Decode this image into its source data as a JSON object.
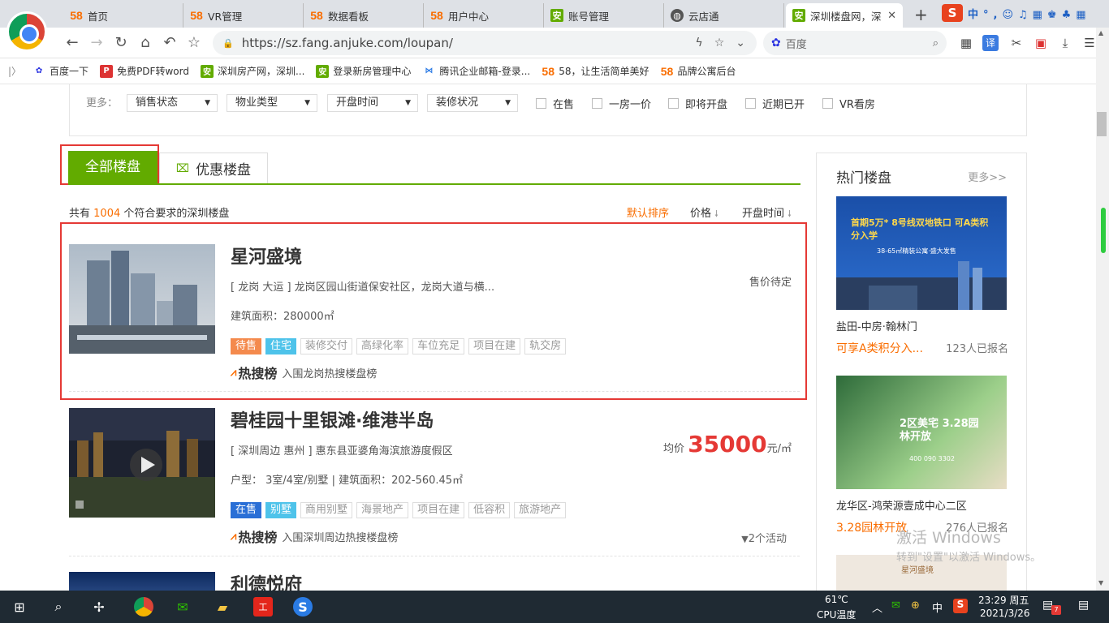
{
  "tabs": [
    {
      "icon": "58",
      "label": "首页"
    },
    {
      "icon": "58",
      "label": "VR管理"
    },
    {
      "icon": "58",
      "label": "数据看板"
    },
    {
      "icon": "58",
      "label": "用户中心"
    },
    {
      "icon": "安",
      "label": "账号管理"
    },
    {
      "icon": "globe",
      "label": "云店通"
    },
    {
      "icon": "安",
      "label": "深圳楼盘网，深"
    }
  ],
  "url": "https://sz.fang.anjuke.com/loupan/",
  "search_placeholder": "百度",
  "bookmarks": [
    "百度一下",
    "免费PDF转word",
    "深圳房产网，深圳...",
    "登录新房管理中心",
    "腾讯企业邮箱-登录...",
    "58，让生活简单美好",
    "品牌公寓后台"
  ],
  "filters": {
    "more_label": "更多：",
    "dropdowns": [
      "销售状态",
      "物业类型",
      "开盘时间",
      "装修状况"
    ],
    "checkboxes": [
      "在售",
      "一房一价",
      "即将开盘",
      "近期已开",
      "VR看房"
    ]
  },
  "list_tabs": {
    "all": "全部楼盘",
    "deals": "优惠楼盘"
  },
  "result": {
    "prefix": "共有",
    "count": "1004",
    "suffix": "个符合要求的深圳楼盘"
  },
  "sort": {
    "default": "默认排序",
    "price": "价格",
    "open_time": "开盘时间"
  },
  "listings": [
    {
      "name": "星河盛境",
      "address": "[ 龙岗 大运 ] 龙岗区园山街道保安社区，龙岗大道与横...",
      "info": "建筑面积：280000㎡",
      "status_tag": "待售",
      "type_tag": "住宅",
      "tags": [
        "装修交付",
        "高绿化率",
        "车位充足",
        "项目在建",
        "轨交房"
      ],
      "hot_label": "热搜榜",
      "hot_text": "入围龙岗热搜楼盘榜",
      "price_text": "售价待定"
    },
    {
      "name": "碧桂园十里银滩·维港半岛",
      "address": "[ 深圳周边 惠州 ] 惠东县亚婆角海滨旅游度假区",
      "info": "户型： 3室/4室/别墅   |   建筑面积：202-560.45㎡",
      "status_tag": "在售",
      "type_tag": "别墅",
      "tags": [
        "商用别墅",
        "海景地产",
        "项目在建",
        "低容积",
        "旅游地产"
      ],
      "hot_label": "热搜榜",
      "hot_text": "入围深圳周边热搜楼盘榜",
      "price_prefix": "均价",
      "price_value": "35000",
      "price_unit": "元/㎡",
      "activities": "2个活动"
    },
    {
      "name": "利德悦府"
    }
  ],
  "sidebar": {
    "title": "热门楼盘",
    "more": "更多>>",
    "items": [
      {
        "name": "盐田-中房·翰林门",
        "promo": "可享A类积分入...",
        "count": "123人已报名",
        "img_text": "首期5万* 8号线双地铁口 可A类积分入学",
        "img_sub": "38-65㎡精装公寓·盛大发售"
      },
      {
        "name": "龙华区-鸿荣源壹成中心二区",
        "promo": "3.28园林开放",
        "count": "276人已报名",
        "img_text": "2区美宅 3.28园林开放",
        "img_sub": "400 090 3302"
      },
      {
        "name": "",
        "promo": "",
        "count": "",
        "img_text": "星河盛境",
        "img_sub": ""
      }
    ]
  },
  "watermark": {
    "line1": "激活 Windows",
    "line2": "转到\"设置\"以激活 Windows。"
  },
  "taskbar": {
    "temp": "61℃",
    "temp_label": "CPU温度",
    "ime": "中",
    "time": "23:29 周五",
    "date": "2021/3/26",
    "notif_count": "7"
  },
  "colors": {
    "green": "#62ab00",
    "orange": "#f96d00",
    "red": "#e53935"
  }
}
